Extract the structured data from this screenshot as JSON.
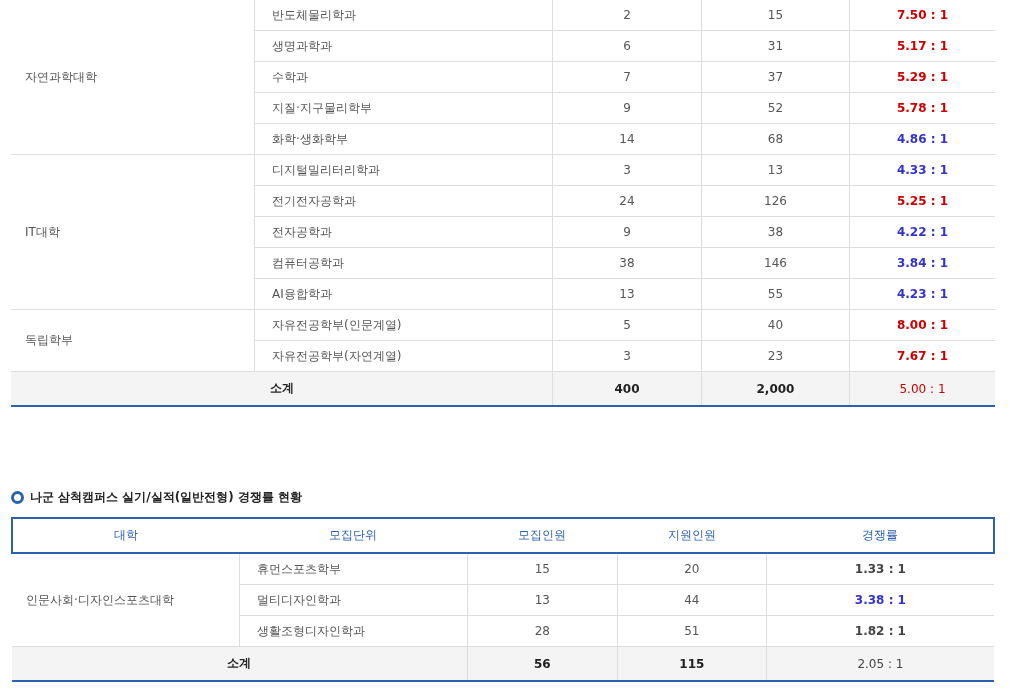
{
  "table_1": {
    "groups": [
      {
        "college": "자연과학대학",
        "rows": [
          {
            "unit": "반도체물리학과",
            "quota": "2",
            "applicants": "15",
            "ratio": "7.50 : 1",
            "color": "#cc0000"
          },
          {
            "unit": "생명과학과",
            "quota": "6",
            "applicants": "31",
            "ratio": "5.17 : 1",
            "color": "#cc0000"
          },
          {
            "unit": "수학과",
            "quota": "7",
            "applicants": "37",
            "ratio": "5.29 : 1",
            "color": "#cc0000"
          },
          {
            "unit": "지질·지구물리학부",
            "quota": "9",
            "applicants": "52",
            "ratio": "5.78 : 1",
            "color": "#cc0000"
          },
          {
            "unit": "화학·생화학부",
            "quota": "14",
            "applicants": "68",
            "ratio": "4.86 : 1",
            "color": "#3333cc"
          }
        ]
      },
      {
        "college": "IT대학",
        "rows": [
          {
            "unit": "디지털밀리터리학과",
            "quota": "3",
            "applicants": "13",
            "ratio": "4.33 : 1",
            "color": "#3333cc"
          },
          {
            "unit": "전기전자공학과",
            "quota": "24",
            "applicants": "126",
            "ratio": "5.25 : 1",
            "color": "#cc0000"
          },
          {
            "unit": "전자공학과",
            "quota": "9",
            "applicants": "38",
            "ratio": "4.22 : 1",
            "color": "#3333cc"
          },
          {
            "unit": "컴퓨터공학과",
            "quota": "38",
            "applicants": "146",
            "ratio": "3.84 : 1",
            "color": "#3333cc"
          },
          {
            "unit": "AI융합학과",
            "quota": "13",
            "applicants": "55",
            "ratio": "4.23 : 1",
            "color": "#3333cc"
          }
        ]
      },
      {
        "college": "독립학부",
        "rows": [
          {
            "unit": "자유전공학부(인문계열)",
            "quota": "5",
            "applicants": "40",
            "ratio": "8.00 : 1",
            "color": "#cc0000"
          },
          {
            "unit": "자유전공학부(자연계열)",
            "quota": "3",
            "applicants": "23",
            "ratio": "7.67 : 1",
            "color": "#cc0000"
          }
        ]
      }
    ],
    "total": {
      "label": "소계",
      "quota": "400",
      "applicants": "2,000",
      "ratio": "5.00 : 1",
      "color": "#cc0000"
    }
  },
  "section_title": "나군 삼척캠퍼스 실기/실적(일반전형) 경쟁률 현황",
  "table_2": {
    "columns": [
      "대학",
      "모집단위",
      "모집인원",
      "지원인원",
      "경쟁률"
    ],
    "groups": [
      {
        "college": "인문사회·디자인스포츠대학",
        "rows": [
          {
            "unit": "휴먼스포츠학부",
            "quota": "15",
            "applicants": "20",
            "ratio": "1.33 : 1",
            "color": "#444444"
          },
          {
            "unit": "멀티디자인학과",
            "quota": "13",
            "applicants": "44",
            "ratio": "3.38 : 1",
            "color": "#3333cc"
          },
          {
            "unit": "생활조형디자인학과",
            "quota": "28",
            "applicants": "51",
            "ratio": "1.82 : 1",
            "color": "#444444"
          }
        ]
      }
    ],
    "total": {
      "label": "소계",
      "quota": "56",
      "applicants": "115",
      "ratio": "2.05 : 1",
      "color": "#444444"
    }
  }
}
